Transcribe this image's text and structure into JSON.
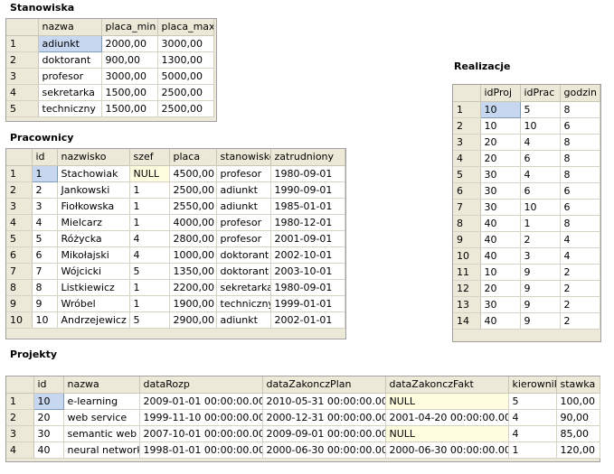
{
  "stanowiska": {
    "title": "Stanowiska",
    "columns": [
      "nazwa",
      "placa_min",
      "placa_max"
    ],
    "rows": [
      [
        "1",
        "adiunkt",
        "2000,00",
        "3000,00"
      ],
      [
        "2",
        "doktorant",
        "900,00",
        "1300,00"
      ],
      [
        "3",
        "profesor",
        "3000,00",
        "5000,00"
      ],
      [
        "4",
        "sekretarka",
        "1500,00",
        "2500,00"
      ],
      [
        "5",
        "techniczny",
        "1500,00",
        "2500,00"
      ]
    ]
  },
  "pracownicy": {
    "title": "Pracownicy",
    "columns": [
      "id",
      "nazwisko",
      "szef",
      "placa",
      "stanowisko",
      "zatrudniony"
    ],
    "rows": [
      [
        "1",
        "1",
        "Stachowiak",
        "NULL",
        "4500,00",
        "profesor",
        "1980-09-01"
      ],
      [
        "2",
        "2",
        "Jankowski",
        "1",
        "2500,00",
        "adiunkt",
        "1990-09-01"
      ],
      [
        "3",
        "3",
        "Fiołkowska",
        "1",
        "2550,00",
        "adiunkt",
        "1985-01-01"
      ],
      [
        "4",
        "4",
        "Mielcarz",
        "1",
        "4000,00",
        "profesor",
        "1980-12-01"
      ],
      [
        "5",
        "5",
        "Różycka",
        "4",
        "2800,00",
        "profesor",
        "2001-09-01"
      ],
      [
        "6",
        "6",
        "Mikołajski",
        "4",
        "1000,00",
        "doktorant",
        "2002-10-01"
      ],
      [
        "7",
        "7",
        "Wójcicki",
        "5",
        "1350,00",
        "doktorant",
        "2003-10-01"
      ],
      [
        "8",
        "8",
        "Listkiewicz",
        "1",
        "2200,00",
        "sekretarka",
        "1980-09-01"
      ],
      [
        "9",
        "9",
        "Wróbel",
        "1",
        "1900,00",
        "techniczny",
        "1999-01-01"
      ],
      [
        "10",
        "10",
        "Andrzejewicz",
        "5",
        "2900,00",
        "adiunkt",
        "2002-01-01"
      ]
    ]
  },
  "realizacje": {
    "title": "Realizacje",
    "columns": [
      "idProj",
      "idPrac",
      "godzin"
    ],
    "rows": [
      [
        "1",
        "10",
        "5",
        "8"
      ],
      [
        "2",
        "10",
        "10",
        "6"
      ],
      [
        "3",
        "20",
        "4",
        "8"
      ],
      [
        "4",
        "20",
        "6",
        "8"
      ],
      [
        "5",
        "30",
        "4",
        "8"
      ],
      [
        "6",
        "30",
        "6",
        "6"
      ],
      [
        "7",
        "30",
        "10",
        "6"
      ],
      [
        "8",
        "40",
        "1",
        "8"
      ],
      [
        "9",
        "40",
        "2",
        "4"
      ],
      [
        "10",
        "40",
        "3",
        "4"
      ],
      [
        "11",
        "10",
        "9",
        "2"
      ],
      [
        "12",
        "20",
        "9",
        "2"
      ],
      [
        "13",
        "30",
        "9",
        "2"
      ],
      [
        "14",
        "40",
        "9",
        "2"
      ]
    ]
  },
  "projekty": {
    "title": "Projekty",
    "columns": [
      "id",
      "nazwa",
      "dataRozp",
      "dataZakonczPlan",
      "dataZakonczFakt",
      "kierownik",
      "stawka"
    ],
    "rows": [
      [
        "1",
        "10",
        "e-learning",
        "2009-01-01 00:00:00.000",
        "2010-05-31 00:00:00.000",
        "NULL",
        "5",
        "100,00"
      ],
      [
        "2",
        "20",
        "web service",
        "1999-11-10 00:00:00.000",
        "2000-12-31 00:00:00.000",
        "2001-04-20 00:00:00.000",
        "4",
        "90,00"
      ],
      [
        "3",
        "30",
        "semantic web",
        "2007-10-01 00:00:00.000",
        "2009-09-01 00:00:00.000",
        "NULL",
        "4",
        "85,00"
      ],
      [
        "4",
        "40",
        "neural network",
        "1998-01-01 00:00:00.000",
        "2000-06-30 00:00:00.000",
        "2000-06-30 00:00:00.000",
        "1",
        "120,00"
      ]
    ]
  }
}
